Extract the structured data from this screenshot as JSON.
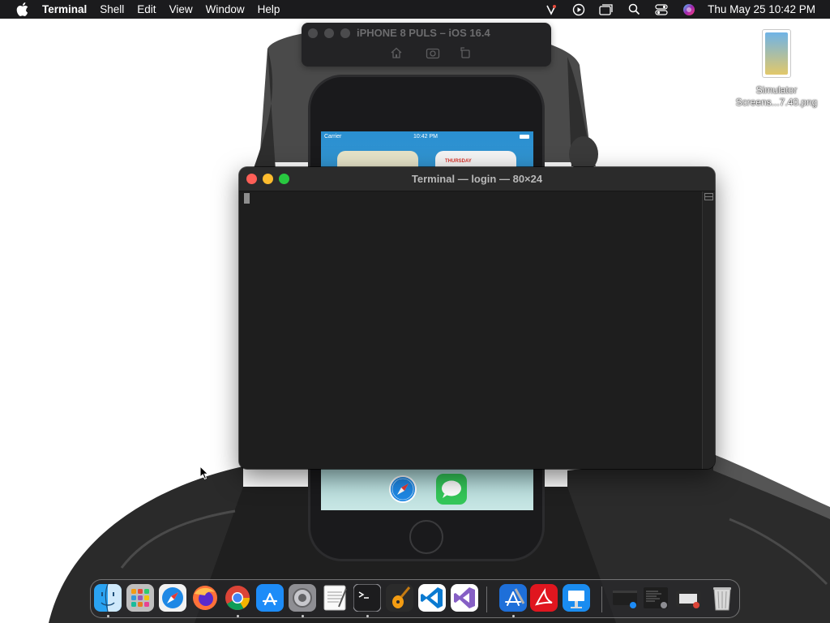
{
  "menubar": {
    "app_name": "Terminal",
    "items": [
      "Shell",
      "Edit",
      "View",
      "Window",
      "Help"
    ],
    "clock": "Thu May 25  10:42 PM",
    "status_icons": [
      "avast-icon",
      "play-icon",
      "window-icon",
      "search-icon",
      "control-center-icon",
      "siri-icon"
    ]
  },
  "simulator": {
    "title": "iPHONE 8 PULS – iOS 16.4",
    "tools": [
      "home-icon",
      "screenshot-icon",
      "rotate-icon"
    ],
    "status_carrier": "Carrier",
    "status_time": "10:42 PM",
    "widget_day": "THURSDAY",
    "dock_apps": [
      "safari-icon",
      "messages-icon"
    ]
  },
  "terminal": {
    "title": "Terminal — login — 80×24",
    "content": ""
  },
  "desktop": {
    "file_label_line1": "Simulator",
    "file_label_line2": "Screens...7.40.png"
  },
  "dock": {
    "apps": [
      {
        "name": "finder-icon",
        "running": true
      },
      {
        "name": "launchpad-icon",
        "running": false
      },
      {
        "name": "safari-icon",
        "running": false
      },
      {
        "name": "firefox-icon",
        "running": false
      },
      {
        "name": "chrome-icon",
        "running": true
      },
      {
        "name": "app-store-icon",
        "running": false
      },
      {
        "name": "system-preferences-icon",
        "running": true
      },
      {
        "name": "textedit-icon",
        "running": false
      },
      {
        "name": "terminal-icon",
        "running": true
      },
      {
        "name": "garageband-icon",
        "running": false
      },
      {
        "name": "vscode-icon",
        "running": false
      },
      {
        "name": "visual-studio-icon",
        "running": false
      },
      {
        "name": "xcode-icon",
        "running": true
      },
      {
        "name": "acrobat-icon",
        "running": false
      },
      {
        "name": "keynote-icon",
        "running": false
      },
      {
        "name": "recent-window-thumb-1",
        "running": false
      },
      {
        "name": "recent-window-thumb-2",
        "running": false
      },
      {
        "name": "recent-window-thumb-3",
        "running": false
      },
      {
        "name": "trash-icon",
        "running": false
      }
    ]
  },
  "colors": {
    "menubar_bg": "#1b1b1d",
    "terminal_bg": "#1e1e1e",
    "close": "#ff5f57",
    "minimize": "#febc2e",
    "zoom": "#28c840"
  }
}
